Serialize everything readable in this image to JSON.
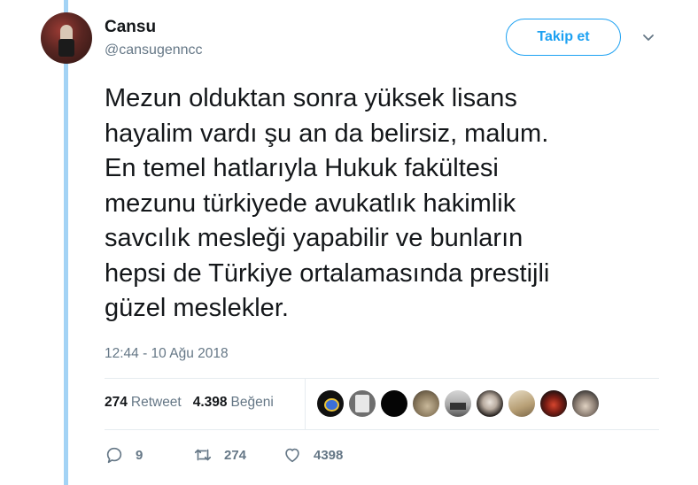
{
  "author": {
    "name": "Cansu",
    "handle": "@cansugenncc"
  },
  "follow_button": {
    "label": "Takip et"
  },
  "tweet": {
    "lines": [
      "Mezun olduktan sonra yüksek lisans",
      "hayalim vardı şu an da belirsiz, malum.",
      "En temel hatlarıyla Hukuk fakültesi",
      "mezunu türkiyede avukatlık hakimlik",
      "savcılık mesleği yapabilir ve bunların",
      "hepsi de Türkiye ortalamasında prestijli",
      "güzel meslekler."
    ],
    "timestamp": "12:44 - 10 Ağu 2018"
  },
  "stats": {
    "retweet_count": "274",
    "retweet_label": "Retweet",
    "like_count": "4.398",
    "like_label": "Beğeni"
  },
  "actions": {
    "reply_count": "9",
    "retweet_count": "274",
    "like_count": "4398"
  },
  "colors": {
    "accent": "#1da1f2",
    "thread_line": "#a3d3f5",
    "secondary_text": "#657786"
  },
  "icons": [
    "chevron-down-icon",
    "reply-icon",
    "retweet-icon",
    "heart-icon"
  ]
}
